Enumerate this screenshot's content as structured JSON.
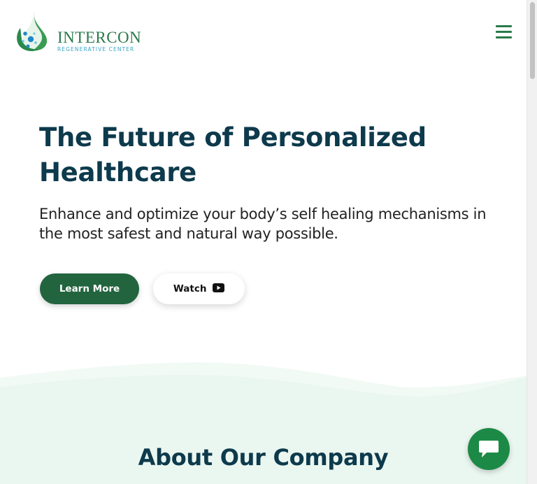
{
  "header": {
    "logo_name": "INTERCON",
    "logo_tagline": "REGENERATIVE CENTER",
    "logo_icon": "water-drop-logo-icon",
    "menu_icon": "hamburger-menu-icon"
  },
  "hero": {
    "title": "The Future of Personalized Healthcare",
    "subtitle": "Enhance and optimize your body’s self healing mechanisms in the most safest and natural way possible.",
    "primary_button": "Learn More",
    "secondary_button": "Watch",
    "secondary_button_icon": "youtube-play-icon"
  },
  "about": {
    "title": "About Our Company"
  },
  "chat": {
    "icon": "chat-bubble-icon"
  },
  "colors": {
    "brand_green": "#22643e",
    "chat_green": "#1c8a46",
    "heading_navy": "#0d3a4c",
    "logo_blue": "#3aa6c9",
    "section_mint": "#eaf6f0"
  }
}
